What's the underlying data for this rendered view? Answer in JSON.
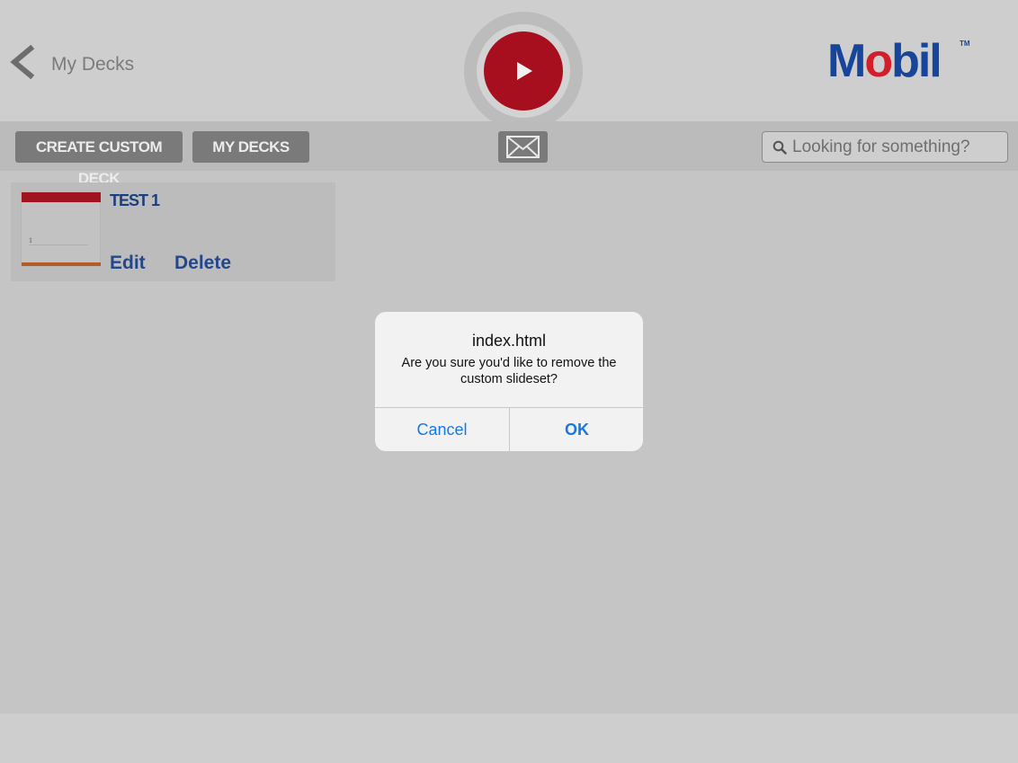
{
  "header": {
    "back_label": "My Decks",
    "logo_prefix": "M",
    "logo_o": "o",
    "logo_suffix": "bil",
    "logo_tm": "TM"
  },
  "toolbar": {
    "create_label": "CREATE CUSTOM DECK",
    "mydecks_label": "MY DECKS",
    "search_placeholder": "Looking for something?"
  },
  "decks": [
    {
      "title": "TEST 1",
      "thumb_number": "1",
      "edit_label": "Edit",
      "delete_label": "Delete"
    }
  ],
  "alert": {
    "title": "index.html",
    "message": "Are you sure you'd like to remove the custom slideset?",
    "cancel_label": "Cancel",
    "ok_label": "OK"
  },
  "colors": {
    "brand_blue": "#17459a",
    "brand_red": "#d21f2b",
    "play_red": "#a70f1f",
    "ios_blue": "#1778e5"
  },
  "icons": [
    "chevron-left-icon",
    "play-icon",
    "mail-icon",
    "search-icon"
  ]
}
